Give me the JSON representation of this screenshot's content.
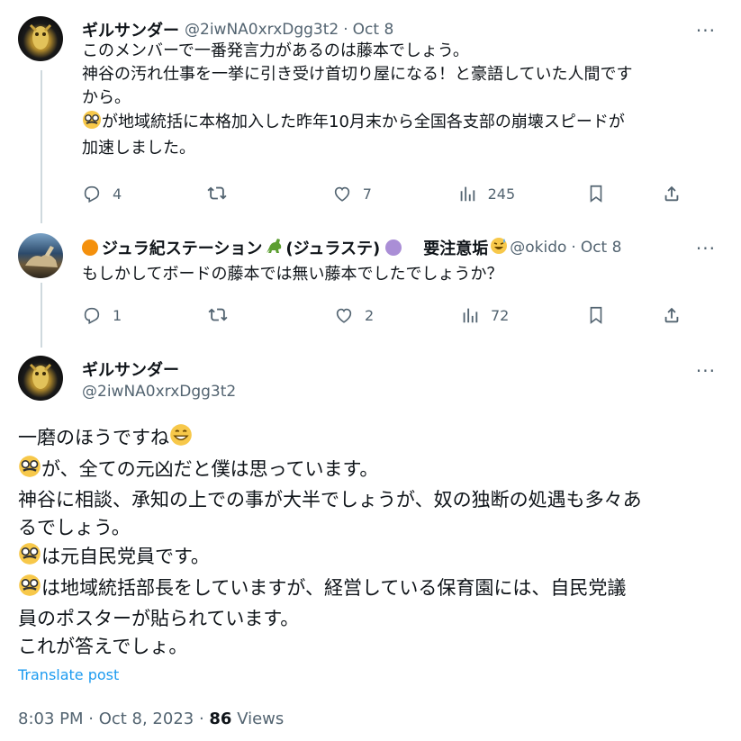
{
  "tweet1": {
    "name": "ギルサンダー",
    "handle": "@2iwNA0xrxDgg3t2",
    "date": "Oct 8",
    "lines": [
      "このメンバーで一番発言力があるのは藤本でしょう。",
      "神谷の汚れ仕事を一挙に引き受け首切り屋になる！と豪語していた人間です",
      "から。",
      "が地域統括に本格加入した昨年10月末から全国各支部の崩壊スピードが",
      "加速しました。"
    ],
    "reply_count": "4",
    "retweet_count": "",
    "like_count": "7",
    "view_count": "245"
  },
  "tweet2": {
    "name": "ジュラ紀ステーション",
    "name_paren": "(ジュラステ)",
    "warning": "要注意垢",
    "handle": "@okido",
    "date": "Oct 8",
    "lines": [
      "もしかしてボードの藤本では無い藤本でしたでしょうか？"
    ],
    "reply_count": "1",
    "like_count": "2",
    "view_count": "72"
  },
  "main": {
    "name": "ギルサンダー",
    "handle": "@2iwNA0xrxDgg3t2",
    "lines": [
      "一磨のほうですね",
      "が、全ての元凶だと僕は思っています。",
      "神谷に相談、承知の上での事が大半でしょうが、奴の独断の処遇も多々あ",
      "るでしょう。",
      "は元自民党員です。",
      "は地域統括部長をしていますが、経営している保育園には、自民党議",
      "員のポスターが貼られています。",
      "これが答えでしょ。"
    ],
    "translate": "Translate post",
    "time": "8:03 PM · Oct 8, 2023 · ",
    "views_count": "86",
    "views_label": " Views"
  },
  "icons": [
    "more-icon",
    "reply-icon",
    "retweet-icon",
    "like-icon",
    "views-icon",
    "bookmark-icon",
    "share-icon",
    "disguise-emoji",
    "grin-emoji"
  ],
  "colors": {
    "link": "#1d9bf0",
    "muted": "#536471",
    "text": "#0f1419",
    "thread": "#cfd9de"
  }
}
